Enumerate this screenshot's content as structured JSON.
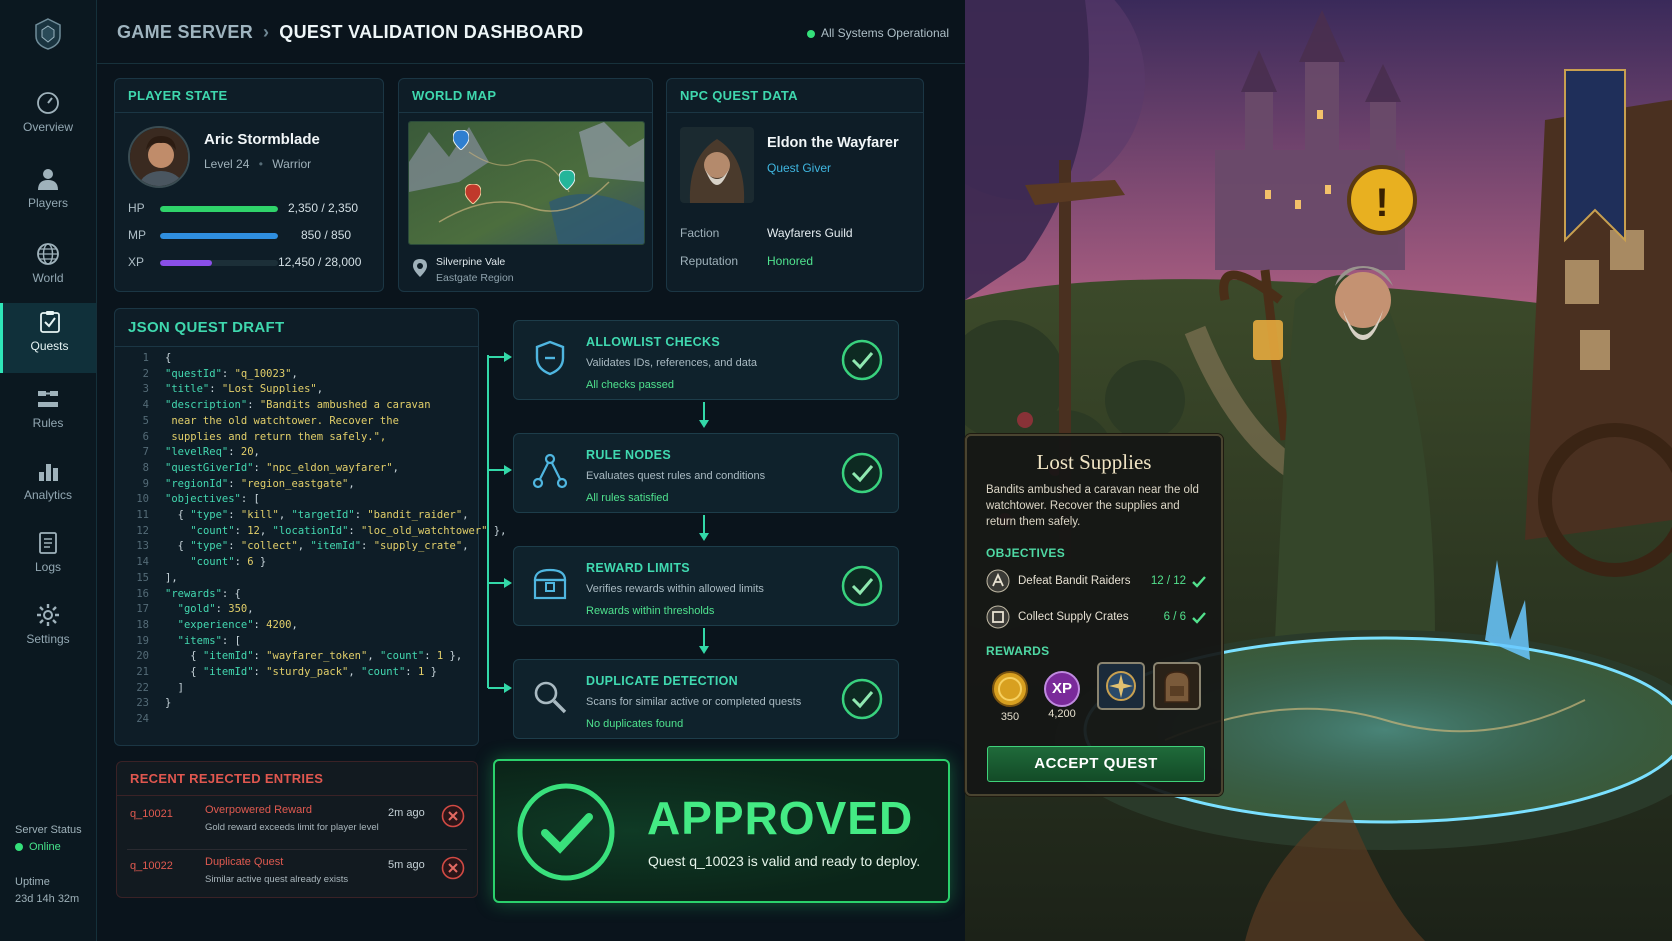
{
  "header": {
    "crumb_root": "GAME SERVER",
    "crumb_sep": "›",
    "crumb_page": "QUEST VALIDATION DASHBOARD",
    "system_status": "All Systems Operational"
  },
  "sidebar": {
    "items": [
      {
        "label": "Overview",
        "icon": "gauge-icon"
      },
      {
        "label": "Players",
        "icon": "user-icon"
      },
      {
        "label": "World",
        "icon": "globe-icon"
      },
      {
        "label": "Quests",
        "icon": "quest-icon"
      },
      {
        "label": "Rules",
        "icon": "sliders-icon"
      },
      {
        "label": "Analytics",
        "icon": "chart-icon"
      },
      {
        "label": "Logs",
        "icon": "doc-icon"
      },
      {
        "label": "Settings",
        "icon": "gear-icon"
      }
    ],
    "active": "Quests",
    "server_status_label": "Server Status",
    "server_status": "Online",
    "uptime_label": "Uptime",
    "uptime": "23d 14h 32m"
  },
  "player_state": {
    "title": "PLAYER STATE",
    "name": "Aric Stormblade",
    "level": "Level 24",
    "dot": "•",
    "class": "Warrior",
    "stats": [
      {
        "label": "HP",
        "value": "2,350 / 2,350",
        "fill": 1.0,
        "color": "#2fd36a"
      },
      {
        "label": "MP",
        "value": "850  /  850",
        "fill": 1.0,
        "color": "#2f8fe0"
      },
      {
        "label": "XP",
        "value": "12,450 / 28,000",
        "fill": 0.44,
        "color": "#8a4fe8"
      }
    ]
  },
  "world_map": {
    "title": "WORLD MAP",
    "location": "Silverpine Vale",
    "region": "Eastgate Region"
  },
  "npc": {
    "title": "NPC QUEST DATA",
    "name": "Eldon the Wayfarer",
    "role": "Quest Giver",
    "faction_label": "Faction",
    "faction": "Wayfarers Guild",
    "reputation_label": "Reputation",
    "reputation": "Honored"
  },
  "json_draft": {
    "title": "JSON QUEST DRAFT",
    "lines": [
      "{",
      "\"questId\": \"q_10023\",",
      "\"title\": \"Lost Supplies\",",
      "\"description\": \"Bandits ambushed a caravan",
      " near the old watchtower. Recover the",
      " supplies and return them safely.\",",
      "\"levelReq\": 20,",
      "\"questGiverId\": \"npc_eldon_wayfarer\",",
      "\"regionId\": \"region_eastgate\",",
      "\"objectives\": [",
      "  { \"type\": \"kill\", \"targetId\": \"bandit_raider\",",
      "    \"count\": 12, \"locationId\": \"loc_old_watchtower\" },",
      "  { \"type\": \"collect\", \"itemId\": \"supply_crate\",",
      "    \"count\": 6 }",
      "],",
      "\"rewards\": {",
      "  \"gold\": 350,",
      "  \"experience\": 4200,",
      "  \"items\": [",
      "    { \"itemId\": \"wayfarer_token\", \"count\": 1 },",
      "    { \"itemId\": \"sturdy_pack\", \"count\": 1 }",
      "  ]",
      "}",
      ""
    ]
  },
  "checks": [
    {
      "title": "ALLOWLIST CHECKS",
      "desc": "Validates IDs, references, and data",
      "result": "All checks passed",
      "icon": "shield-icon"
    },
    {
      "title": "RULE NODES",
      "desc": "Evaluates quest rules and conditions",
      "result": "All rules satisfied",
      "icon": "nodes-icon"
    },
    {
      "title": "REWARD LIMITS",
      "desc": "Verifies rewards within allowed limits",
      "result": "Rewards within thresholds",
      "icon": "chest-icon"
    },
    {
      "title": "DUPLICATE DETECTION",
      "desc": "Scans for similar active or completed quests",
      "result": "No duplicates found",
      "icon": "magnifier-icon"
    }
  ],
  "rejected": {
    "title": "RECENT REJECTED ENTRIES",
    "entries": [
      {
        "id": "q_10021",
        "reason": "Overpowered Reward",
        "detail": "Gold reward exceeds limit for player level",
        "time": "2m ago"
      },
      {
        "id": "q_10022",
        "reason": "Duplicate Quest",
        "detail": "Similar active quest already exists",
        "time": "5m ago"
      }
    ]
  },
  "approved": {
    "title": "APPROVED",
    "message": "Quest q_10023 is valid and ready to deploy."
  },
  "quest_card": {
    "title": "Lost Supplies",
    "description": "Bandits ambushed a caravan near the old watchtower. Recover the supplies and return them safely.",
    "objectives_label": "OBJECTIVES",
    "objectives": [
      {
        "label": "Defeat Bandit Raiders",
        "count": "12 / 12"
      },
      {
        "label": "Collect Supply Crates",
        "count": "6 / 6"
      }
    ],
    "rewards_label": "REWARDS",
    "rewards": [
      {
        "label": "350",
        "icon": "gold-coin-icon"
      },
      {
        "label": "4,200",
        "icon": "xp-icon",
        "badge": "XP"
      },
      {
        "label": "",
        "icon": "token-icon"
      },
      {
        "label": "",
        "icon": "backpack-icon"
      }
    ],
    "accept_label": "ACCEPT QUEST",
    "exclaim": "!"
  },
  "colors": {
    "accent": "#3fd8ae",
    "success": "#2bd16c",
    "danger": "#e05050",
    "bg": "#0a141c"
  }
}
